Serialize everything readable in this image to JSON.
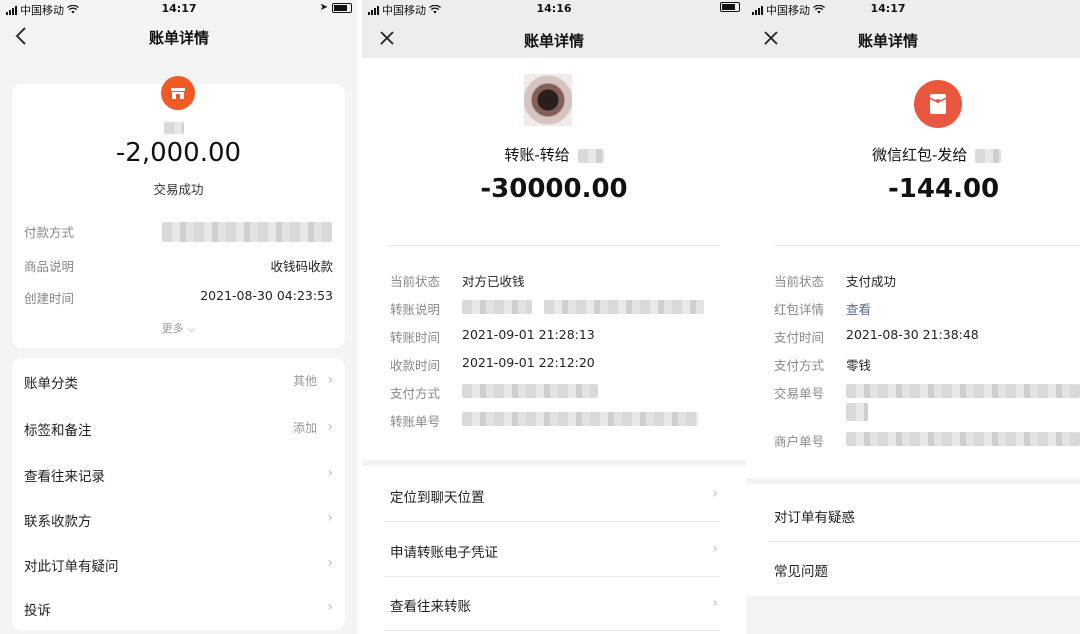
{
  "panel1": {
    "status": {
      "carrier": "中国移动",
      "time": "14:17"
    },
    "nav": {
      "title": "账单详情"
    },
    "amount": "-2,000.00",
    "status_text": "交易成功",
    "details": [
      {
        "label": "付款方式",
        "value": ""
      },
      {
        "label": "商品说明",
        "value": "收钱码收款"
      },
      {
        "label": "创建时间",
        "value": "2021-08-30 04:23:53"
      }
    ],
    "more_label": "更多",
    "menu": [
      {
        "label": "账单分类",
        "value": "其他"
      },
      {
        "label": "标签和备注",
        "value": "添加"
      },
      {
        "label": "查看往来记录",
        "value": ""
      },
      {
        "label": "联系收款方",
        "value": ""
      },
      {
        "label": "对此订单有疑问",
        "value": ""
      },
      {
        "label": "投诉",
        "value": ""
      }
    ]
  },
  "panel2": {
    "status": {
      "carrier": "中国移动",
      "time": "14:16"
    },
    "nav": {
      "title": "账单详情"
    },
    "subtitle": "转账-转给",
    "amount": "-30000.00",
    "details": [
      {
        "label": "当前状态",
        "value": "对方已收钱"
      },
      {
        "label": "转账说明",
        "value": ""
      },
      {
        "label": "转账时间",
        "value": "2021-09-01 21:28:13"
      },
      {
        "label": "收款时间",
        "value": "2021-09-01 22:12:20"
      },
      {
        "label": "支付方式",
        "value": ""
      },
      {
        "label": "转账单号",
        "value": ""
      }
    ],
    "menu": [
      {
        "label": "定位到聊天位置"
      },
      {
        "label": "申请转账电子凭证"
      },
      {
        "label": "查看往来转账"
      }
    ]
  },
  "panel3": {
    "status": {
      "carrier": "中国移动",
      "time": "14:17"
    },
    "nav": {
      "title": "账单详情"
    },
    "subtitle": "微信红包-发给",
    "amount": "-144.00",
    "details": [
      {
        "label": "当前状态",
        "value": "支付成功"
      },
      {
        "label": "红包详情",
        "value": "查看"
      },
      {
        "label": "支付时间",
        "value": "2021-08-30 21:38:48"
      },
      {
        "label": "支付方式",
        "value": "零钱"
      },
      {
        "label": "交易单号",
        "value": ""
      },
      {
        "label": "商户单号",
        "value": ""
      }
    ],
    "menu": [
      {
        "label": "对订单有疑惑"
      },
      {
        "label": "常见问题"
      }
    ]
  },
  "colors": {
    "alipay_orange": "#f15a22",
    "wechat_red": "#e9573f",
    "link_blue": "#576b95"
  },
  "icons": [
    "signal-icon",
    "wifi-icon",
    "battery-icon",
    "location-arrow-icon",
    "back-arrow-icon",
    "close-icon",
    "chevron-right-icon",
    "chevron-down-icon",
    "merchant-shop-icon",
    "red-packet-icon"
  ]
}
